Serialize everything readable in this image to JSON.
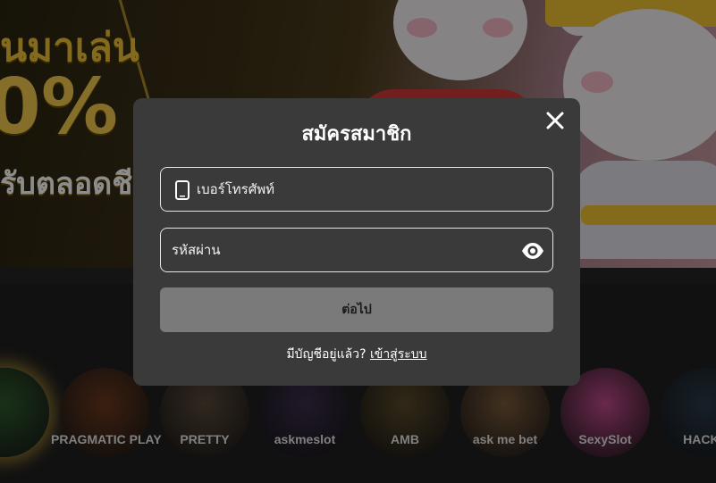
{
  "banner": {
    "line1": "นมาเล่น",
    "line2": "0%",
    "line3": "รับตลอดชี"
  },
  "modal": {
    "title": "สมัครสมาชิก",
    "phone_placeholder": "เบอร์โทรศัพท์",
    "password_placeholder": "รหัสผ่าน",
    "next_label": "ต่อไป",
    "have_account_text": "มีบัญชีอยู่แล้ว?",
    "login_link": "เข้าสู่ระบบ"
  },
  "providers": [
    {
      "name": "",
      "color": "#2e5a2e"
    },
    {
      "name": "PRAGMATIC PLAY",
      "color": "#6b3a1e"
    },
    {
      "name": "PRETTY",
      "color": "#5a4a3a"
    },
    {
      "name": "askmeslot",
      "color": "#3a2d4a"
    },
    {
      "name": "AMB",
      "color": "#5a4a2a"
    },
    {
      "name": "ask me bet",
      "color": "#7a5a3a"
    },
    {
      "name": "SexySlot",
      "color": "#c04a8a"
    },
    {
      "name": "HACKS",
      "color": "#2a3a4a"
    }
  ],
  "colors": {
    "modal_bg": "#3a3a3a",
    "button_bg": "#7a7a7a",
    "banner_gold": "#f0c23a"
  }
}
